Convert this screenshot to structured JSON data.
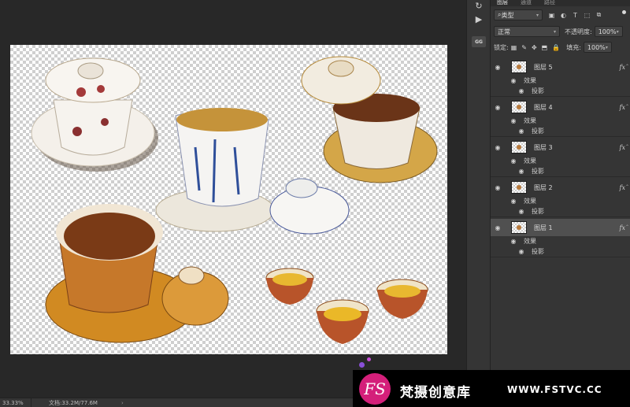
{
  "canvas": {
    "zoom": "33.33%",
    "doc_info": "文档:33.2M/77.6M"
  },
  "panel_tabs": [
    "图层",
    "通道",
    "路径"
  ],
  "filter": {
    "kind_label": "类型"
  },
  "blend": {
    "mode": "正常",
    "opacity_label": "不透明度:",
    "opacity_value": "100%"
  },
  "lock": {
    "label": "锁定:",
    "fill_label": "填充:",
    "fill_value": "100%"
  },
  "layers": [
    {
      "name": "图层 5",
      "effects_label": "效果",
      "shadow_label": "投影",
      "fx": "fx",
      "selected": false
    },
    {
      "name": "图层 4",
      "effects_label": "效果",
      "shadow_label": "投影",
      "fx": "fx",
      "selected": false
    },
    {
      "name": "图层 3",
      "effects_label": "效果",
      "shadow_label": "投影",
      "fx": "fx",
      "selected": false
    },
    {
      "name": "图层 2",
      "effects_label": "效果",
      "shadow_label": "投影",
      "fx": "fx",
      "selected": false
    },
    {
      "name": "图层 1",
      "effects_label": "效果",
      "shadow_label": "投影",
      "fx": "fx",
      "selected": true
    }
  ],
  "watermark": {
    "logo_text": "FS",
    "brand": "梵摄创意库",
    "site": "WWW.FSTVC.CC"
  },
  "icons": {
    "eye": "eye-icon",
    "search": "search-icon",
    "play": "play-icon",
    "history": "history-icon"
  }
}
